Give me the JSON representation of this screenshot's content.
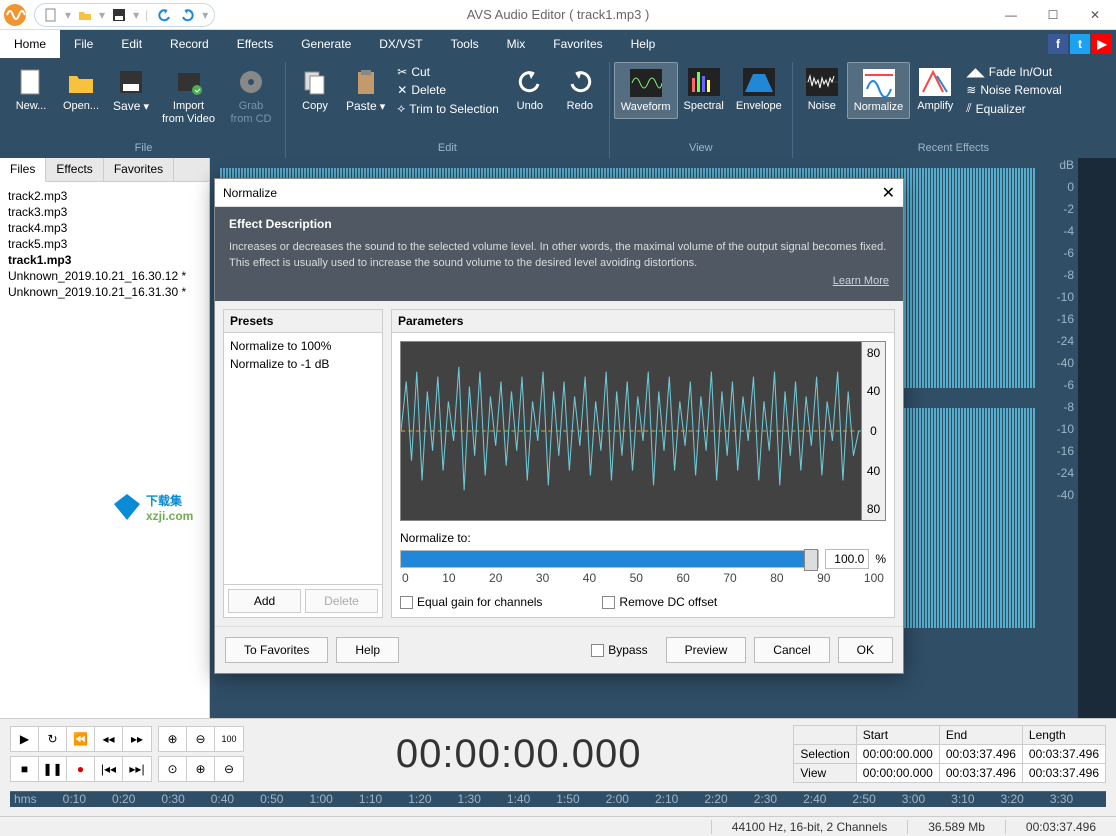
{
  "title": "AVS Audio Editor  ( track1.mp3 )",
  "qat": {
    "new": "New",
    "open": "Open",
    "save": "Save",
    "undo": "Undo",
    "redo": "Redo"
  },
  "menu": [
    "Home",
    "File",
    "Edit",
    "Record",
    "Effects",
    "Generate",
    "DX/VST",
    "Tools",
    "Mix",
    "Favorites",
    "Help"
  ],
  "ribbon": {
    "file": {
      "new": "New...",
      "open": "Open...",
      "save": "Save",
      "import": "Import\nfrom Video",
      "grab": "Grab\nfrom CD",
      "group": "File"
    },
    "edit": {
      "copy": "Copy",
      "paste": "Paste",
      "cut": "Cut",
      "delete": "Delete",
      "trim": "Trim to Selection",
      "undo": "Undo",
      "redo": "Redo",
      "group": "Edit"
    },
    "view": {
      "waveform": "Waveform",
      "spectral": "Spectral",
      "envelope": "Envelope",
      "group": "View"
    },
    "effects": {
      "noise": "Noise",
      "normalize": "Normalize",
      "amplify": "Amplify",
      "fade": "Fade In/Out",
      "noiseremoval": "Noise Removal",
      "equalizer": "Equalizer",
      "group": "Recent Effects"
    }
  },
  "side_tabs": [
    "Files",
    "Effects",
    "Favorites"
  ],
  "files": [
    "track2.mp3",
    "track3.mp3",
    "track4.mp3",
    "track5.mp3",
    "track1.mp3",
    "Unknown_2019.10.21_16.30.12 *",
    "Unknown_2019.10.21_16.31.30 *"
  ],
  "current_file_index": 4,
  "db_scale": [
    "dB",
    "0",
    "-2",
    "-4",
    "-6",
    "-8",
    "-10",
    "-16",
    "-24",
    "-40",
    "-6",
    "-8",
    "-10",
    "-16",
    "-24",
    "-40"
  ],
  "timeline_labels": [
    "hms",
    "0:10",
    "0:20",
    "0:30",
    "0:40",
    "0:50",
    "1:00",
    "1:10",
    "1:20",
    "1:30",
    "1:40",
    "1:50",
    "2:00",
    "2:10",
    "2:20",
    "2:30",
    "2:40",
    "2:50",
    "3:00",
    "3:10",
    "3:20",
    "3:30"
  ],
  "dialog": {
    "title": "Normalize",
    "desc_title": "Effect Description",
    "desc_text": "Increases or decreases the sound to the selected volume level. In other words, the maximal volume of the output signal becomes fixed. This effect is usually used to increase the sound volume to the desired level avoiding distortions.",
    "learn_more": "Learn More",
    "presets_label": "Presets",
    "presets": [
      "Normalize to 100%",
      "Normalize to -1 dB"
    ],
    "add": "Add",
    "delete": "Delete",
    "params_label": "Parameters",
    "wave_axis": [
      "80",
      "40",
      "0",
      "40",
      "80"
    ],
    "normalize_to": "Normalize to:",
    "slider_value": "100.0",
    "percent": "%",
    "slider_scale": [
      "0",
      "10",
      "20",
      "30",
      "40",
      "50",
      "60",
      "70",
      "80",
      "90",
      "100"
    ],
    "equal_gain": "Equal gain for channels",
    "dc_offset": "Remove DC offset",
    "to_favorites": "To Favorites",
    "help": "Help",
    "bypass": "Bypass",
    "preview": "Preview",
    "cancel": "Cancel",
    "ok": "OK"
  },
  "transport": {
    "big_time": "00:00:00.000",
    "headers": {
      "start": "Start",
      "end": "End",
      "length": "Length",
      "selection": "Selection",
      "view": "View"
    },
    "selection": {
      "start": "00:00:00.000",
      "end": "00:03:37.496",
      "length": "00:03:37.496"
    },
    "view": {
      "start": "00:00:00.000",
      "end": "00:03:37.496",
      "length": "00:03:37.496"
    }
  },
  "status": {
    "format": "44100 Hz, 16-bit, 2 Channels",
    "size": "36.589 Mb",
    "duration": "00:03:37.496"
  },
  "colors": {
    "ribbon": "#304e66",
    "accent": "#2188d8",
    "wave": "#5ab8d6"
  }
}
